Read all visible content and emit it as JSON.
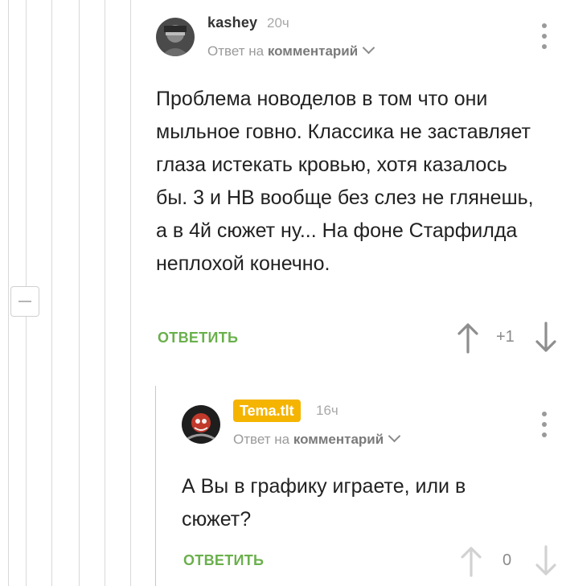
{
  "comments": [
    {
      "username": "kashey",
      "time": "20ч",
      "reply_prefix": "Ответ на",
      "reply_target": "комментарий",
      "text": "Проблема новоделов в том что они мыльное говно. Классика не заставляет глаза истекать кровью, хотя казалось бы. 3 и НВ вообще без слез не глянешь, а в 4й сюжет ну... На фоне Старфилда неплохой конечно.",
      "reply_label": "ОТВЕТИТЬ",
      "rating": "+1"
    },
    {
      "username": "Tema.tlt",
      "time": "16ч",
      "reply_prefix": "Ответ на",
      "reply_target": "комментарий",
      "text": "А Вы в графику играете, или в сюжет?",
      "reply_label": "ОТВЕТИТЬ",
      "rating": "0"
    }
  ],
  "colors": {
    "reply_green": "#6ab04c",
    "badge_yellow": "#f5b400",
    "thread_line": "#d9d9d9"
  },
  "icons": [
    "collapse-icon",
    "more-menu-icon",
    "chevron-down-icon",
    "arrow-up-icon",
    "arrow-down-icon"
  ]
}
